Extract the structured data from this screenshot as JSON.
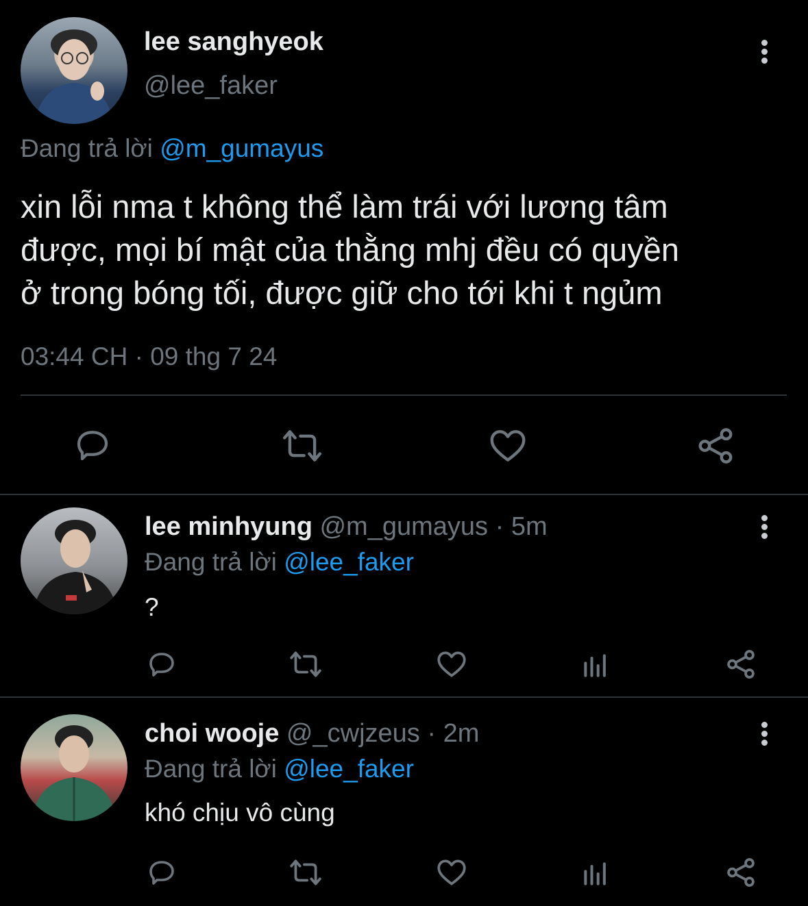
{
  "main_tweet": {
    "author_name": "lee sanghyeok",
    "author_handle": "@lee_faker",
    "reply_prefix": "Đang trả lời",
    "reply_to": "@m_gumayus",
    "text_lines": [
      "xin lỗi nma t không thể làm trái với lương tâm",
      "được, mọi bí mật của thằng mhj đều có quyền",
      "ở trong bóng tối, được giữ cho tới khi t ngủm"
    ],
    "timestamp": "03:44 CH · 09 thg 7 24",
    "actions": [
      "reply-icon",
      "retweet-icon",
      "like-icon",
      "share-icon"
    ]
  },
  "replies": [
    {
      "author_name": "lee minhyung",
      "author_handle": "@m_gumayus",
      "time": "· 5m",
      "reply_prefix": "Đang trả lời",
      "reply_to": "@lee_faker",
      "text": "?",
      "actions": [
        "reply-icon",
        "retweet-icon",
        "like-icon",
        "analytics-icon",
        "share-icon"
      ]
    },
    {
      "author_name": "choi wooje",
      "author_handle": "@_cwjzeus",
      "time": "· 2m",
      "reply_prefix": "Đang trả lời",
      "reply_to": "@lee_faker",
      "text": "khó chịu vô cùng",
      "actions": [
        "reply-icon",
        "retweet-icon",
        "like-icon",
        "analytics-icon",
        "share-icon"
      ]
    }
  ],
  "colors": {
    "background": "#000000",
    "text": "#e7e9ea",
    "muted": "#6e767d",
    "link": "#1d9bf0",
    "divider": "#2f3336"
  }
}
